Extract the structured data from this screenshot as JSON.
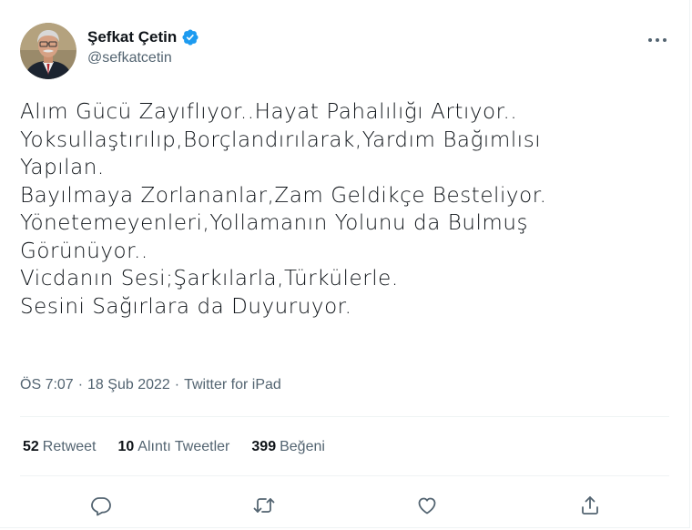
{
  "user": {
    "display_name": "Şefkat Çetin",
    "handle": "@sefkatcetin",
    "verified": true,
    "avatar_icon": "profile-photo"
  },
  "tweet": {
    "lines": [
      "Alım Gücü Zayıflıyor..Hayat Pahalılığı Artıyor..",
      "Yoksullaştırılıp,Borçlandırılarak,Yardım Bağımlısı",
      "Yapılan.",
      "Bayılmaya Zorlananlar,Zam Geldikçe Besteliyor.",
      "Yönetemeyenleri,Yollamanın Yolunu da Bulmuş",
      "Görünüyor..",
      "Vicdanın Sesi;Şarkılarla,Türkülerle.",
      "Sesini Sağırlara da Duyuruyor."
    ]
  },
  "meta": {
    "time": "ÖS 7:07",
    "separator": "·",
    "date": "18 Şub 2022",
    "source": "Twitter for iPad"
  },
  "stats": {
    "retweets": {
      "count": "52",
      "label": "Retweet"
    },
    "quotes": {
      "count": "10",
      "label": "Alıntı Tweetler"
    },
    "likes": {
      "count": "399",
      "label": "Beğeni"
    }
  },
  "actions": [
    "reply-icon",
    "retweet-icon",
    "like-icon",
    "share-icon"
  ],
  "colors": {
    "text": "#0f1419",
    "secondary": "#536471",
    "verified": "#1d9bf0",
    "divider": "#eff3f4"
  }
}
